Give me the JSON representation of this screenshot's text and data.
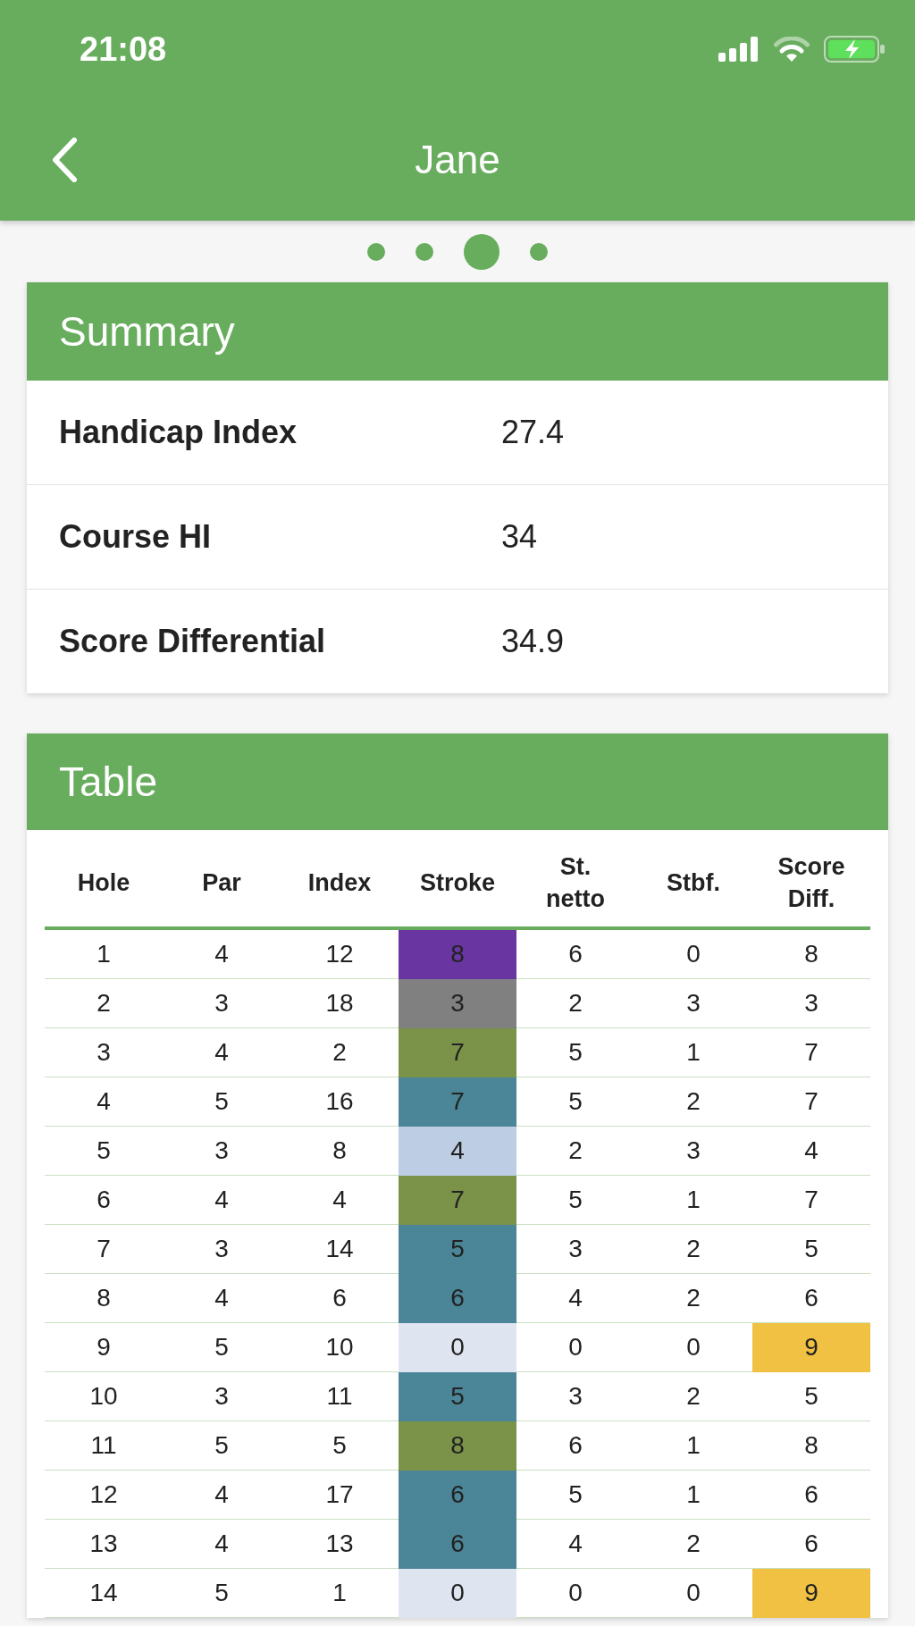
{
  "status_bar": {
    "time": "21:08"
  },
  "nav_bar": {
    "title": "Jane"
  },
  "page_dots": [
    {
      "selected": false
    },
    {
      "selected": false
    },
    {
      "selected": true
    },
    {
      "selected": false
    }
  ],
  "summary": {
    "title": "Summary",
    "rows": [
      {
        "label": "Handicap Index",
        "value": "27.4"
      },
      {
        "label": "Course HI",
        "value": "34"
      },
      {
        "label": "Score Differential",
        "value": "34.9"
      }
    ]
  },
  "table": {
    "title": "Table",
    "columns": [
      "Hole",
      "Par",
      "Index",
      "Stroke",
      "St. netto",
      "Stbf.",
      "Score Diff."
    ],
    "rows": [
      {
        "hole": "1",
        "par": "4",
        "index": "12",
        "stroke": {
          "value": "8",
          "color": "#6935a0"
        },
        "st_netto": "6",
        "stbf": "0",
        "score_diff": {
          "value": "8",
          "highlighted": false
        }
      },
      {
        "hole": "2",
        "par": "3",
        "index": "18",
        "stroke": {
          "value": "3",
          "color": "#808080"
        },
        "st_netto": "2",
        "stbf": "3",
        "score_diff": {
          "value": "3",
          "highlighted": false
        }
      },
      {
        "hole": "3",
        "par": "4",
        "index": "2",
        "stroke": {
          "value": "7",
          "color": "#7b9249"
        },
        "st_netto": "5",
        "stbf": "1",
        "score_diff": {
          "value": "7",
          "highlighted": false
        }
      },
      {
        "hole": "4",
        "par": "5",
        "index": "16",
        "stroke": {
          "value": "7",
          "color": "#4b8598"
        },
        "st_netto": "5",
        "stbf": "2",
        "score_diff": {
          "value": "7",
          "highlighted": false
        }
      },
      {
        "hole": "5",
        "par": "3",
        "index": "8",
        "stroke": {
          "value": "4",
          "color": "#bccde4"
        },
        "st_netto": "2",
        "stbf": "3",
        "score_diff": {
          "value": "4",
          "highlighted": false
        }
      },
      {
        "hole": "6",
        "par": "4",
        "index": "4",
        "stroke": {
          "value": "7",
          "color": "#7b9249"
        },
        "st_netto": "5",
        "stbf": "1",
        "score_diff": {
          "value": "7",
          "highlighted": false
        }
      },
      {
        "hole": "7",
        "par": "3",
        "index": "14",
        "stroke": {
          "value": "5",
          "color": "#4b8598"
        },
        "st_netto": "3",
        "stbf": "2",
        "score_diff": {
          "value": "5",
          "highlighted": false
        }
      },
      {
        "hole": "8",
        "par": "4",
        "index": "6",
        "stroke": {
          "value": "6",
          "color": "#4b8598"
        },
        "st_netto": "4",
        "stbf": "2",
        "score_diff": {
          "value": "6",
          "highlighted": false
        }
      },
      {
        "hole": "9",
        "par": "5",
        "index": "10",
        "stroke": {
          "value": "0",
          "color": "#dfe5f0"
        },
        "st_netto": "0",
        "stbf": "0",
        "score_diff": {
          "value": "9",
          "highlighted": true
        }
      },
      {
        "hole": "10",
        "par": "3",
        "index": "11",
        "stroke": {
          "value": "5",
          "color": "#4b8598"
        },
        "st_netto": "3",
        "stbf": "2",
        "score_diff": {
          "value": "5",
          "highlighted": false
        }
      },
      {
        "hole": "11",
        "par": "5",
        "index": "5",
        "stroke": {
          "value": "8",
          "color": "#7b9249"
        },
        "st_netto": "6",
        "stbf": "1",
        "score_diff": {
          "value": "8",
          "highlighted": false
        }
      },
      {
        "hole": "12",
        "par": "4",
        "index": "17",
        "stroke": {
          "value": "6",
          "color": "#4b8598"
        },
        "st_netto": "5",
        "stbf": "1",
        "score_diff": {
          "value": "6",
          "highlighted": false
        }
      },
      {
        "hole": "13",
        "par": "4",
        "index": "13",
        "stroke": {
          "value": "6",
          "color": "#4b8598"
        },
        "st_netto": "4",
        "stbf": "2",
        "score_diff": {
          "value": "6",
          "highlighted": false
        }
      },
      {
        "hole": "14",
        "par": "5",
        "index": "1",
        "stroke": {
          "value": "0",
          "color": "#dfe5f0"
        },
        "st_netto": "0",
        "stbf": "0",
        "score_diff": {
          "value": "9",
          "highlighted": true
        }
      }
    ]
  }
}
